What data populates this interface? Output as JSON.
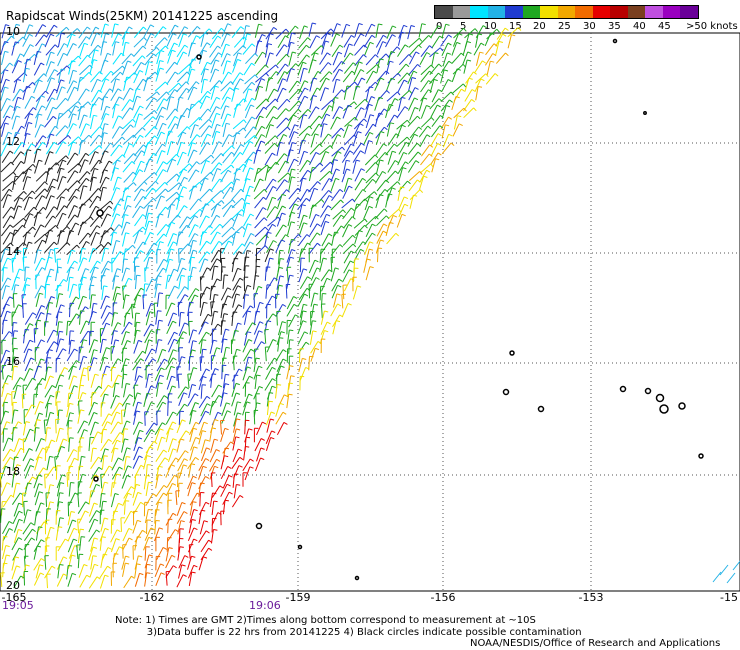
{
  "title": "Rapidscat Winds(25KM) 20141225 ascending",
  "legend": {
    "colors": [
      "#4a4a4a",
      "#9a9a9a",
      "#00e5ff",
      "#22b2e6",
      "#1f3bd1",
      "#1fa821",
      "#f2e000",
      "#f2a800",
      "#f26b00",
      "#e60000",
      "#b80000",
      "#7a3f1f",
      "#c04fe0",
      "#9a00c0",
      "#6a0099"
    ],
    "ticks": [
      "0",
      "5",
      "10",
      "15",
      "20",
      "25",
      "30",
      "35",
      "40",
      "45",
      ">50 knots"
    ]
  },
  "axes": {
    "lat_labels": [
      "10",
      "12",
      "14",
      "16",
      "18",
      "20"
    ],
    "lon_labels": [
      "-165",
      "-162",
      "-159",
      "-156",
      "-153",
      "-15"
    ],
    "time_labels": [
      "19:05",
      "19:06"
    ]
  },
  "note": {
    "line1": "Note: 1) Times are GMT 2)Times along bottom correspond to measurement at ~10S",
    "line2": "3)Data buffer is 22 hrs from 20141225 4) Black circles indicate possible contamination"
  },
  "credit": "NOAA/NESDIS/Office of Research and Applications",
  "islands": [
    {
      "name": "dot"
    },
    {
      "name": "dot"
    },
    {
      "name": "dot"
    },
    {
      "name": "dot"
    },
    {
      "name": "dot"
    },
    {
      "name": "dot"
    },
    {
      "name": "dot"
    },
    {
      "name": "dot"
    },
    {
      "name": "dot"
    },
    {
      "name": "dot"
    },
    {
      "name": "dot"
    },
    {
      "name": "dot"
    }
  ]
}
